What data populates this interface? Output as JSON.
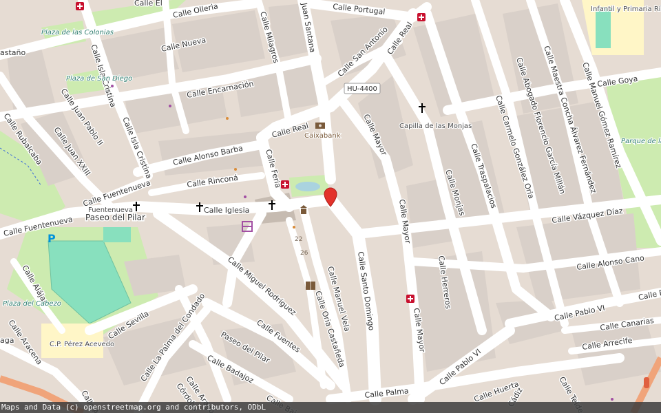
{
  "map": {
    "colors": {
      "background": "#e6dcd3",
      "block": "#d9d0c9",
      "road": "#ffffff",
      "park": "#cdebb0",
      "pitch": "#88e0be",
      "school": "#fff6c7",
      "marker": "#e3322b",
      "pharmacy": "#c8102e",
      "place_of_worship": "#000000",
      "parking": "#0092da"
    },
    "streets": {
      "calle_el": "Calle El",
      "calle_olleria": "Calle Olleria",
      "calle_nueva": "Calle Nueva",
      "calle_milagros": "Calle Milagros",
      "juan_santana": "Juan Santana",
      "calle_portugal": "Calle Portugal",
      "calle_real_top": "Calle Real",
      "calle_san_antonio": "Calle San Antonio",
      "calle_encarnacion": "Calle Encarnación",
      "calle_isla_cristina_top": "Calle Isla Cristina",
      "calle_isla_cristina_mid": "Calle Isla Cristina",
      "calle_juan_pablo_ii": "Calle Juan Pablo II",
      "calle_juan_xxiii": "Calle Juan XXIII",
      "calle_rubalcaba": "Calle Rubalcaba",
      "calle_real_center": "Calle Real",
      "calle_alonso_barba": "Calle Alonso Barba",
      "calle_rincona": "Calle Rinconá",
      "calle_feria": "Calle Feria",
      "calle_iglesia": "Calle Iglesia",
      "calle_fuentenueva": "Calle Fuentenueva",
      "calle_fuentenueva_2": "Calle Fuentenueva",
      "calle_mayor_top": "Calle Mayor",
      "calle_mayor_mid": "Calle Mayor",
      "calle_mayor_low": "Calle Mayor",
      "calle_monjas": "Calle Monjas",
      "calle_traspalacios": "Calle Traspalacios",
      "calle_carmelo": "Calle Carmelo González Oria",
      "calle_abogado": "Calle Abogado Florencio García Millán",
      "calle_maestra": "Calle Maestra Concha Álvarez Fernández",
      "calle_manuel_gomez": "Calle Manuel Gómez Ramírez",
      "calle_goya": "Calle Goya",
      "calle_vazquez_diaz": "Calle Vázquez Díaz",
      "calle_alonso_cano": "Calle Alonso Cano",
      "calle_pablo_vi_right": "Calle Pablo VI",
      "calle_p": "Calle P",
      "calle_canarias": "Calle Canarias",
      "calle_arrecife": "Calle Arrecife",
      "calle_pablo_vi_low": "Calle Pablo VI",
      "calle_huerta": "Calle Huerta",
      "calle_palma": "Calle Palma",
      "calle_santo_domingo": "Calle Santo Domingo",
      "calle_herreros": "Calle Herreros",
      "calle_manuel_vela": "Calle Manuel Vela",
      "calle_oria_castaneda": "Calle Oria Castañeda",
      "calle_miguel_rodriguez": "Calle Miguel Rodríguez",
      "calle_fuentes": "Calle Fuentes",
      "paseo_del_pilar": "Paseo del Pilar",
      "calle_badajoz": "Calle Badajoz",
      "calle_la_palma": "Calle La Palma del Condado",
      "calle_sevilla": "Calle Sevilla",
      "calle_aracena": "Calle Aracena",
      "calle_alajar": "Calle Alájar",
      "calle_aragon_1": "Calle Arag",
      "calle_aragon_2": "Calle Aragó",
      "calle_cordoba": "Córdoba",
      "calle_bai": "Calle Bai",
      "calle_teide": "Calle Teide",
      "cadiz": "Cádiz",
      "calle_aga": "aga",
      "calle_castano": "astaño"
    },
    "places": {
      "plaza_colonias": "Plaza de las Colonias",
      "plaza_san_diego": "Plaza de San Diego",
      "plaza_cabezo": "Plaza del Cabezo",
      "paseo_pilar": "Paseo del Pilar",
      "fuentenueva": "Fuentenueva",
      "parque_gaga": "Parque de la Gaga"
    },
    "pois": {
      "caixabank": "Caixabank",
      "capilla": "Capilla de las Monjas",
      "school_infantil": "Infantil y Primaria Río Piedras",
      "cp_perez": "C.P. Pérez Acevedo"
    },
    "road_ref": "HU-4400",
    "house_numbers": [
      "22",
      "26"
    ],
    "icons": {
      "pharmacy": "pharmacy-cross-icon",
      "church": "church-cross-icon",
      "bank": "bank-icon",
      "library": "library-book-icon",
      "museum": "museum-icon",
      "marker": "location-marker-icon",
      "parking": "parking-icon",
      "traffic_light": "traffic-light-icon",
      "fountain": "fountain-icon"
    },
    "attribution": "Maps and Data (c) openstreetmap.org and contributors, ODbL"
  }
}
